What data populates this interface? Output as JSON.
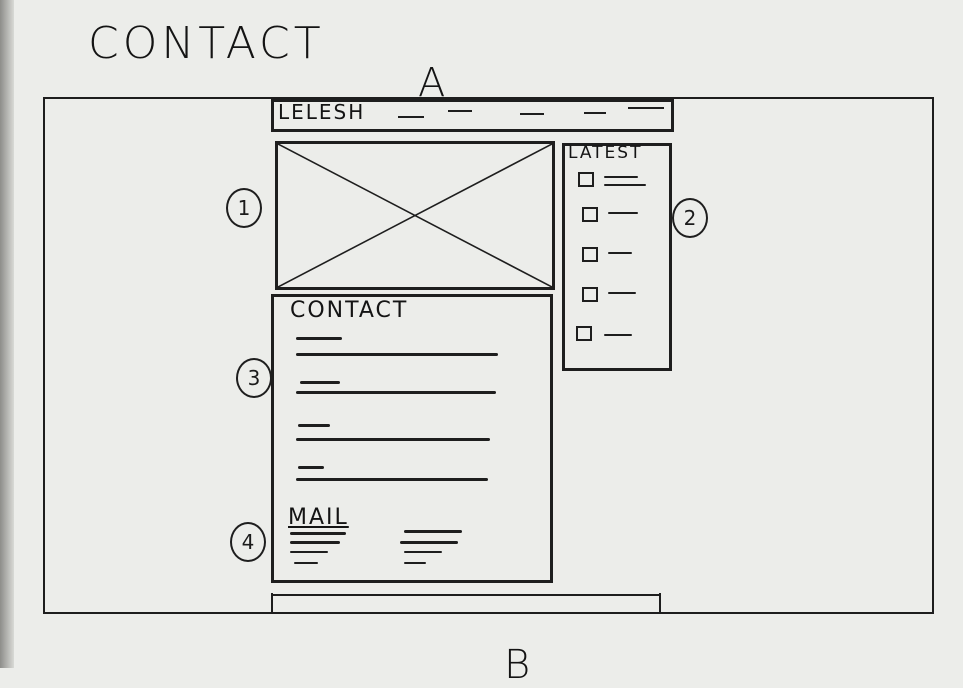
{
  "page": {
    "title": "CONTACT",
    "label_top": "A",
    "label_bottom": "B"
  },
  "header": {
    "text": "LELESH"
  },
  "annotations": [
    "1",
    "2",
    "3",
    "4"
  ],
  "latest": {
    "title": "LATEST",
    "item_count": 5
  },
  "contact": {
    "title": "CONTACT",
    "field_count": 4
  },
  "mail": {
    "title": "MAIL"
  },
  "colors": {
    "paper": "#ecedea",
    "ink": "#1e1e1e"
  }
}
